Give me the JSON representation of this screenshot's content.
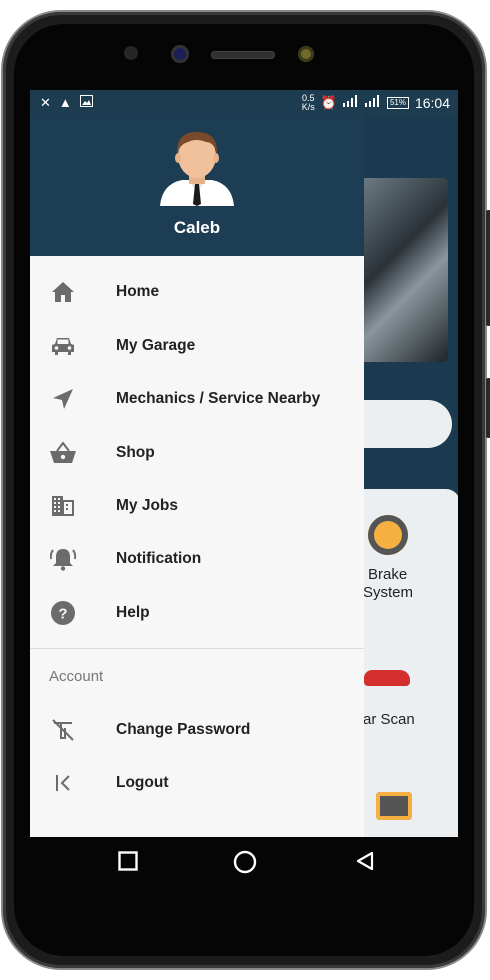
{
  "status_bar": {
    "left_icons": [
      "missed-call-icon",
      "warning-icon",
      "image-icon"
    ],
    "net_speed_value": "0.5",
    "net_speed_unit": "K/s",
    "battery": "51%",
    "time": "16:04"
  },
  "drawer": {
    "user_name": "Caleb",
    "menu_items": [
      {
        "label": "Home",
        "icon": "home-icon"
      },
      {
        "label": "My Garage",
        "icon": "car-icon"
      },
      {
        "label": "Mechanics / Service Nearby",
        "icon": "navigation-icon"
      },
      {
        "label": "Shop",
        "icon": "basket-icon"
      },
      {
        "label": "My Jobs",
        "icon": "building-icon"
      },
      {
        "label": "Notification",
        "icon": "bell-icon"
      },
      {
        "label": "Help",
        "icon": "help-icon"
      }
    ],
    "account_section_title": "Account",
    "account_items": [
      {
        "label": "Change Password",
        "icon": "key-off-icon"
      },
      {
        "label": "Logout",
        "icon": "logout-icon"
      }
    ]
  },
  "background_content": {
    "card_label_1_line1": "Brake",
    "card_label_1_line2": "System",
    "card_label_2": "ar Scan"
  },
  "navigation_bar": {
    "buttons": [
      "recents-button",
      "home-button",
      "back-button"
    ]
  },
  "colors": {
    "header": "#1c3d54",
    "drawer_bg": "#f7f7f7",
    "icon_gray": "#6b6b6b"
  }
}
